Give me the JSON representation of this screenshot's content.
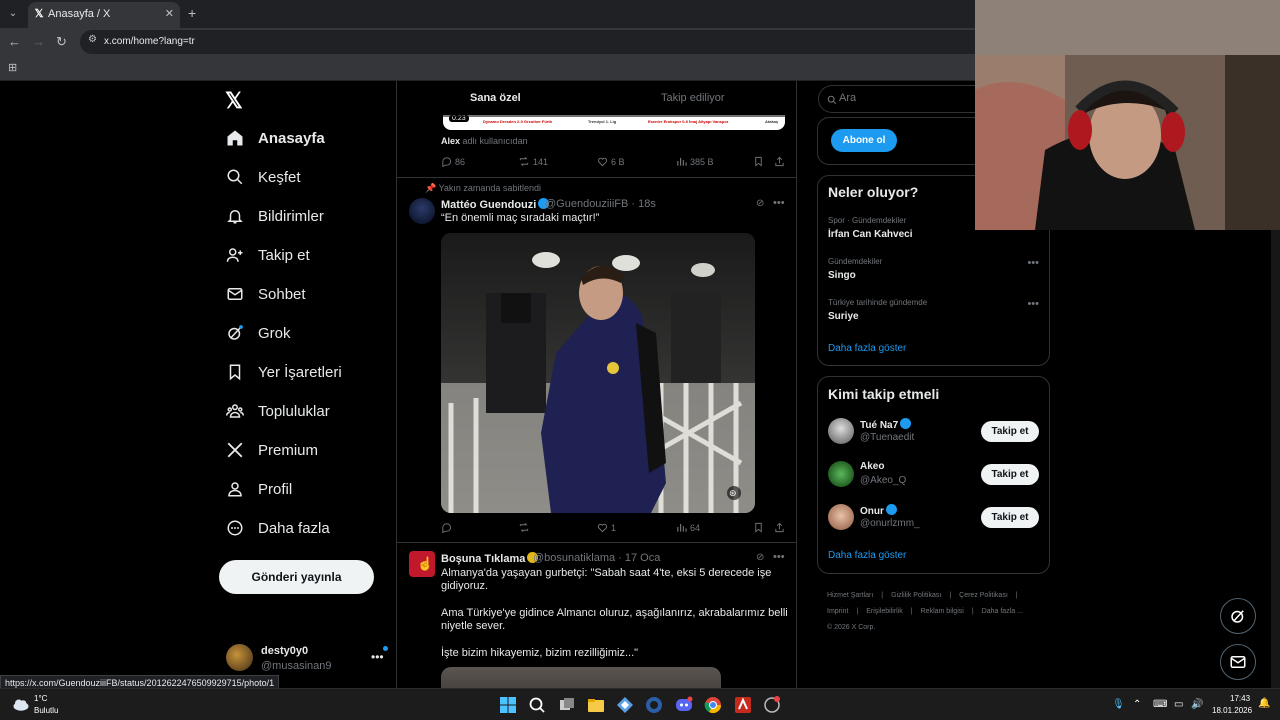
{
  "browser": {
    "tab_title": "Anasayfa / X",
    "url": "x.com/home?lang=tr",
    "status_url": "https://x.com/GuendouziiiFB/status/2012622476509929715/photo/1"
  },
  "nav": {
    "items": [
      {
        "label": "Anasayfa",
        "icon": "home-icon"
      },
      {
        "label": "Keşfet",
        "icon": "search-icon"
      },
      {
        "label": "Bildirimler",
        "icon": "bell-icon"
      },
      {
        "label": "Takip et",
        "icon": "add-user-icon"
      },
      {
        "label": "Sohbet",
        "icon": "mail-icon"
      },
      {
        "label": "Grok",
        "icon": "grok-icon"
      },
      {
        "label": "Yer İşaretleri",
        "icon": "bookmark-icon"
      },
      {
        "label": "Topluluklar",
        "icon": "communities-icon"
      },
      {
        "label": "Premium",
        "icon": "x-icon"
      },
      {
        "label": "Profil",
        "icon": "profile-icon"
      },
      {
        "label": "Daha fazla",
        "icon": "more-circle-icon"
      }
    ],
    "post_button": "Gönderi yayınla",
    "account": {
      "name": "desty0y0",
      "handle": "@musasinan9"
    }
  },
  "timeline": {
    "tabs": [
      "Sana özel",
      "Takip ediliyor"
    ],
    "prev_tweet": {
      "video_time": "0:23",
      "strip_texts": [
        "Dynamo Dresden 2-0 Greuther Fürth",
        "Trendyol 1. Lig",
        "Esenler Erokspor 0-0 İmaj Altyapı Vanspor",
        "Atakaş"
      ],
      "social_user": "Alex",
      "social_suffix": "adlı kullanıcıdan",
      "replies": "86",
      "reposts": "141",
      "likes": "6 B",
      "views": "385 B"
    },
    "tweet1": {
      "pinned_label": "Yakın zamanda sabitlendi",
      "name": "Mattéo Guendouzi",
      "handle_time": "@GuendouziiiFB · 18s",
      "text": "“En önemli maç sıradaki maçtır!”",
      "replies": "",
      "reposts": "",
      "likes": "1",
      "views": "64"
    },
    "tweet2": {
      "name": "Boşuna Tıklama",
      "handle_time": "@bosunatiklama · 17 Oca",
      "line1": "Almanya'da yaşayan gurbetçi: \"Sabah saat 4'te, eksi 5 derecede işe",
      "line2": "gidiyoruz.",
      "line3": "Ama Türkiye'ye gidince Almancı oluruz, aşağılanırız, akrabalarımız belli",
      "line4": "niyetle sever.",
      "line5": "İşte bizim hikayemiz, bizim rezilliğimiz...\""
    }
  },
  "right": {
    "search_placeholder": "Ara",
    "subscribe": "Abone ol",
    "trends_title": "Neler oluyor?",
    "trends": [
      {
        "meta": "Spor · Gündemdekiler",
        "name": "İrfan Can Kahveci"
      },
      {
        "meta": "Gündemdekiler",
        "name": "Singo"
      },
      {
        "meta": "Türkiye tarihinde gündemde",
        "name": "Suriye"
      }
    ],
    "trends_show_more": "Daha fazla göster",
    "wtf_title": "Kimi takip etmeli",
    "wtf": [
      {
        "name": "Tué Na7",
        "handle": "@Tuenaedit",
        "verified": true
      },
      {
        "name": "Akeo",
        "handle": "@Akeo_Q",
        "verified": false
      },
      {
        "name": "Onur",
        "handle": "@onurlzmm_",
        "verified": true
      }
    ],
    "follow_label": "Takip et",
    "wtf_show_more": "Daha fazla göster",
    "footer": [
      "Hizmet Şartları",
      "|",
      "Gizlilik Politikası",
      "|",
      "Çerez Politikası",
      "|",
      "Imprint",
      "|",
      "Erişilebilirlik",
      "|",
      "Reklam bilgisi",
      "|",
      "Daha fazla ...",
      "© 2026 X Corp."
    ]
  },
  "taskbar": {
    "temp": "1°C",
    "weather": "Bulutlu",
    "time": "17:43",
    "date": "18.01.2026"
  },
  "colors": {
    "accent": "#1d9bf0",
    "background": "#000000",
    "border": "#2f3336",
    "muted": "#71767b"
  }
}
